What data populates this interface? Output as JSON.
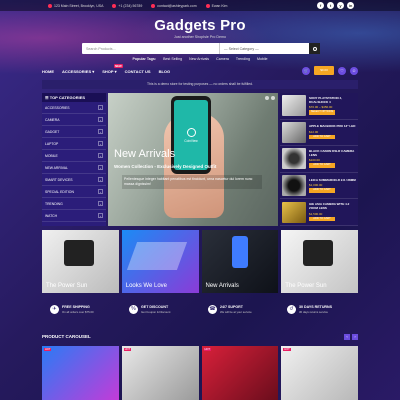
{
  "topbar": {
    "address": "123 Main Street, Brooklyn, USA",
    "phone": "+1 (234) 56789",
    "email": "contact@ashleypark.com",
    "account": "Ewan Kim"
  },
  "social": [
    "f",
    "t",
    "y",
    "in"
  ],
  "brand": {
    "title": "Gadgets Pro",
    "subtitle": "Just another ShopIsle Pro Demo"
  },
  "search": {
    "placeholder": "Search Products...",
    "category": "— Select Category —"
  },
  "popular": {
    "label": "Popular Tags:",
    "tags": [
      "Best Selling",
      "New Arrivals",
      "Camera",
      "Trending",
      "Mobile"
    ]
  },
  "nav": {
    "items": [
      "HOME",
      "ACCESSORIES",
      "SHOP",
      "CONTACT US",
      "BLOG"
    ],
    "new_badge": "NEW",
    "cart": "$0.00"
  },
  "notice": "This is a demo store for testing purposes — no orders shall be fulfilled.",
  "categories": {
    "title": "TOP CATEGORIES",
    "items": [
      "ACCESSORIES",
      "CAMERA",
      "GADGET",
      "LAPTOP",
      "MOBILE",
      "NEW ARRIVAL",
      "SMART DEVICES",
      "SPECIAL EDITION",
      "TRENDING",
      "WATCH"
    ]
  },
  "slider": {
    "heading": "New Arrivals",
    "subheading": "Women Collection - Exclusively Designed Outfit",
    "text": "Pellentesque integer habitant penatibus est tincidunt, urna nascetur dui lorem nunc massa dignissim!",
    "app_name": "CoinView"
  },
  "products": [
    {
      "name": "SONY PLAYSTATION 4, DUALSHOCK 4",
      "price": "$70.00 – $450.00",
      "button": "SELECT OPTIONS"
    },
    {
      "name": "APPLE MACBOOK PRO 13\" LED",
      "price": "$12.00",
      "button": "ADD TO CART"
    },
    {
      "name": "BLACK CANON DSLR CAMERA LENS",
      "price": "$100.00",
      "button": "ADD TO CART"
    },
    {
      "name": "LEICA SUMMARON-R 2.8 / 28MM",
      "price": "$1,000.00",
      "button": "ADD TO CART"
    },
    {
      "name": "GIE ASIA CAMERA WITH 4.2 ZOOM LENS",
      "price": "$1,500.00",
      "button": "ADD TO CART"
    }
  ],
  "banners": [
    "The Power Sun",
    "Looks We Love",
    "New Arrivals",
    "The Power Sun"
  ],
  "features": [
    {
      "icon": "✈",
      "title": "FREE SHIPPING",
      "text": "On all orders over $75.00"
    },
    {
      "icon": "%",
      "title": "GET DISCOUNT",
      "text": "Get Coupon & Discount"
    },
    {
      "icon": "☎",
      "title": "24/7 SUPORT",
      "text": "We will be at your service"
    },
    {
      "icon": "↺",
      "title": "30 DAYS RETURNS",
      "text": "30 days returns service"
    }
  ],
  "carousel": {
    "title": "PRODUCT CAROUSEL",
    "hot": "HOT"
  },
  "colors": {
    "accent": "#f5a623",
    "primary": "#2b1d7a",
    "badge": "#e91e63"
  }
}
